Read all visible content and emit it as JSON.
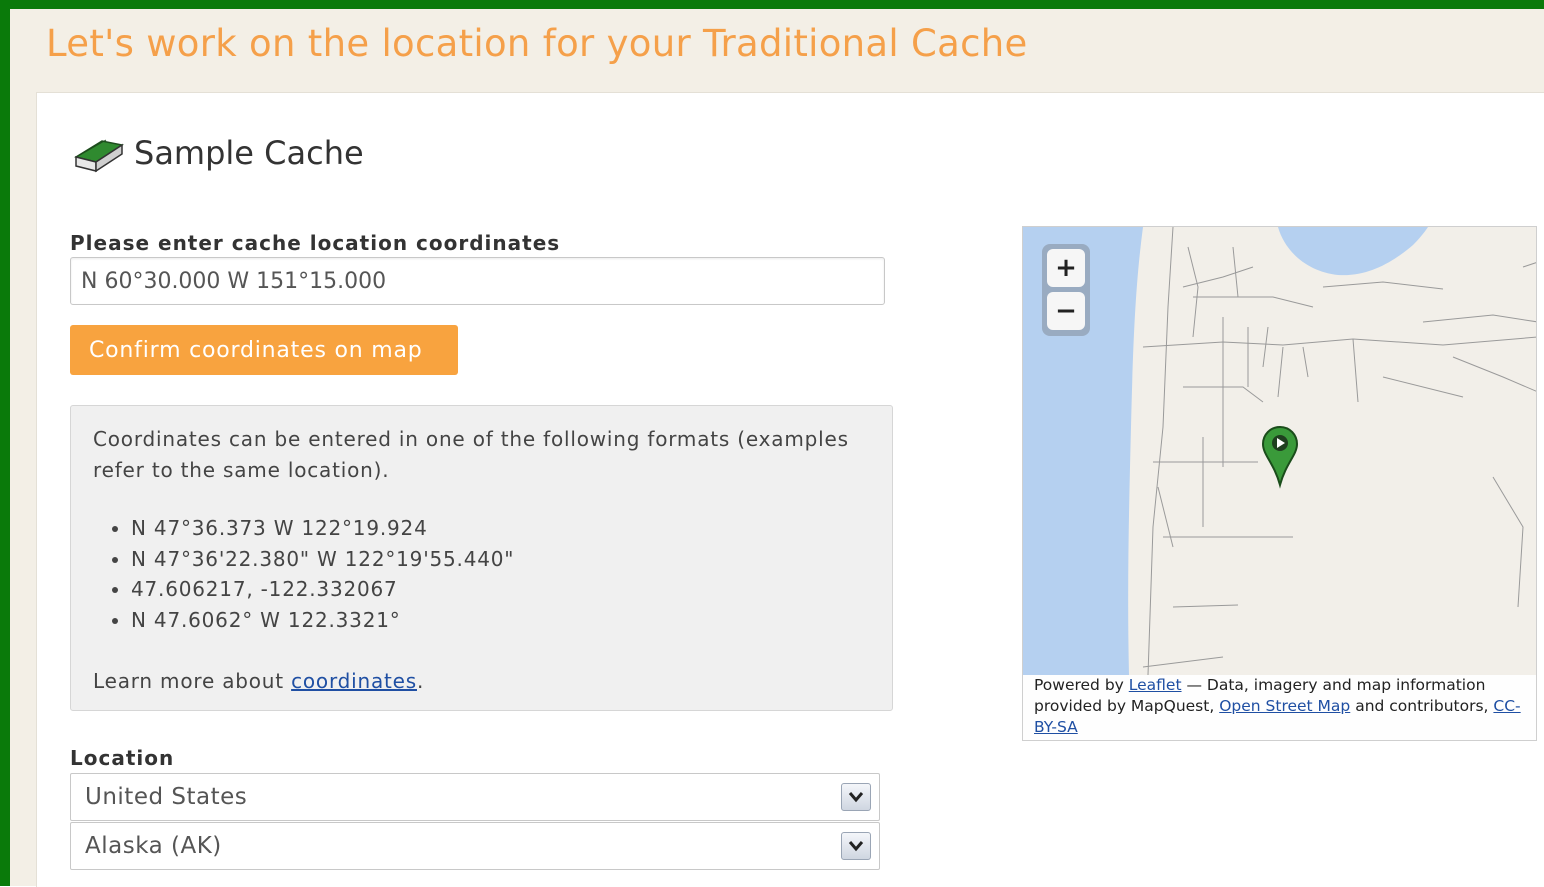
{
  "page": {
    "title": "Let's work on the location for your Traditional Cache"
  },
  "cache": {
    "name": "Sample Cache",
    "icon": "traditional-cache-icon"
  },
  "coordinates": {
    "label": "Please enter cache location coordinates",
    "value": "N 60°30.000 W 151°15.000",
    "confirm_button": "Confirm coordinates on map"
  },
  "help": {
    "intro": "Coordinates can be entered in one of the following formats (examples refer to the same location).",
    "examples": [
      "N 47°36.373 W 122°19.924",
      "N 47°36'22.380\" W 122°19'55.440\"",
      "47.606217, -122.332067",
      "N 47.6062° W 122.3321°"
    ],
    "learn_more_prefix": "Learn more about ",
    "learn_more_link": "coordinates",
    "learn_more_suffix": "."
  },
  "location": {
    "label": "Location",
    "country": "United States",
    "state": "Alaska (AK)"
  },
  "map": {
    "zoom_in": "+",
    "zoom_out": "−",
    "attribution": {
      "powered_by": "Powered by ",
      "leaflet": "Leaflet",
      "data_text": " — Data, imagery and map information provided by MapQuest, ",
      "osm": "Open Street Map",
      "contributors": " and contributors, ",
      "license": "CC-BY-SA"
    }
  },
  "colors": {
    "frame_green": "#0a7a0a",
    "accent_orange": "#f8a33f",
    "title_orange": "#f5a04a",
    "link_blue": "#1f4fa3",
    "water_blue": "#b5d0f0",
    "marker_green": "#3a9a3a"
  }
}
